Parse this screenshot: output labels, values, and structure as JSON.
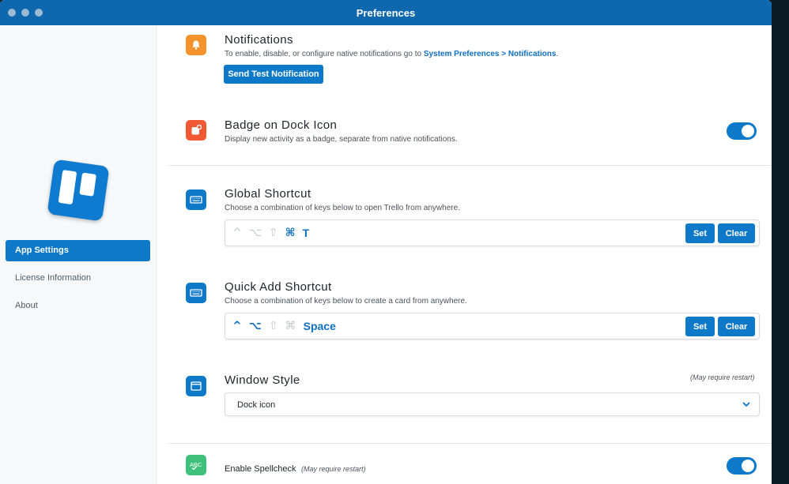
{
  "window": {
    "title": "Preferences"
  },
  "colors": {
    "accent": "#0f79c9",
    "titlebar": "#0f68ad",
    "orange": "#f4932b",
    "red": "#ef5a35",
    "green": "#3fc07a"
  },
  "sidebar": {
    "items": [
      {
        "label": "App Settings",
        "active": true
      },
      {
        "label": "License Information"
      },
      {
        "label": "About"
      }
    ]
  },
  "sections": {
    "notifications": {
      "title": "Notifications",
      "desc_prefix": "To enable, disable, or configure native notifications go to ",
      "desc_link": "System Preferences > Notifications",
      "desc_suffix": ".",
      "button": "Send Test Notification",
      "icon": "bell-icon"
    },
    "badge": {
      "title": "Badge on Dock Icon",
      "desc": "Display new activity as a badge, separate from native notifications.",
      "enabled": true,
      "icon": "badge-icon"
    },
    "global_shortcut": {
      "title": "Global Shortcut",
      "desc": "Choose a combination of keys below to open Trello from anywhere.",
      "keys": {
        "ctrl": "^",
        "option": "⌥",
        "shift": "⇧",
        "cmd": "⌘",
        "key": "T"
      },
      "set": "Set",
      "clear": "Clear",
      "icon": "keyboard-icon"
    },
    "quick_add": {
      "title": "Quick Add Shortcut",
      "desc": "Choose a combination of keys below to create a card from anywhere.",
      "keys": {
        "ctrl": "^",
        "option": "⌥",
        "shift": "⇧",
        "cmd": "⌘",
        "key": "Space"
      },
      "set": "Set",
      "clear": "Clear",
      "icon": "keyboard-icon"
    },
    "window_style": {
      "title": "Window Style",
      "note": "(May require restart)",
      "selected": "Dock icon",
      "icon": "window-icon"
    },
    "spellcheck": {
      "title": "Enable Spellcheck",
      "note": "(May require restart)",
      "enabled": true,
      "icon": "spellcheck-icon"
    }
  }
}
